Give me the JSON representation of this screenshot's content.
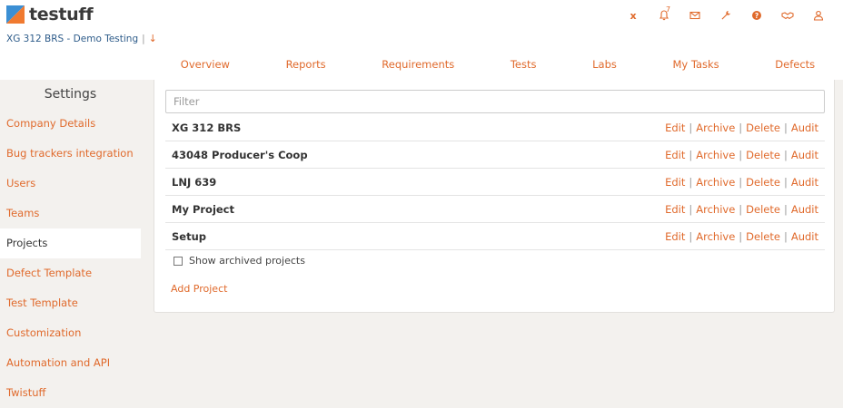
{
  "brand": {
    "name": "testuff",
    "logo_icon": "testuff-logo-icon",
    "colors": {
      "accent": "#e06a2c",
      "logo_blue": "#3b8fd4",
      "logo_orange": "#f07a30"
    }
  },
  "project_selector": {
    "current": "XG 312 BRS - Demo Testing",
    "separator": "|",
    "arrow": "↓"
  },
  "top_icons": [
    {
      "name": "excel-icon",
      "glyph": "x"
    },
    {
      "name": "bell-icon",
      "count": "7"
    },
    {
      "name": "mail-icon"
    },
    {
      "name": "wrench-icon"
    },
    {
      "name": "help-icon"
    },
    {
      "name": "handshake-icon"
    },
    {
      "name": "user-icon"
    }
  ],
  "nav": {
    "items": [
      "Overview",
      "Reports",
      "Requirements",
      "Tests",
      "Labs",
      "My Tasks",
      "Defects"
    ]
  },
  "sidebar": {
    "title": "Settings",
    "active": "Projects",
    "items": [
      "Company Details",
      "Bug trackers integration",
      "Users",
      "Teams",
      "Projects",
      "Defect Template",
      "Test Template",
      "Customization",
      "Automation and API",
      "Twistuff"
    ]
  },
  "projects": {
    "filter_placeholder": "Filter",
    "action_separator": "|",
    "actions": [
      "Edit",
      "Archive",
      "Delete",
      "Audit"
    ],
    "rows": [
      {
        "name": "XG 312 BRS"
      },
      {
        "name": "43048 Producer's Coop"
      },
      {
        "name": "LNJ 639"
      },
      {
        "name": "My Project"
      },
      {
        "name": "Setup"
      }
    ],
    "show_archived_label": "Show archived projects",
    "show_archived_checked": false,
    "add_label": "Add Project"
  }
}
